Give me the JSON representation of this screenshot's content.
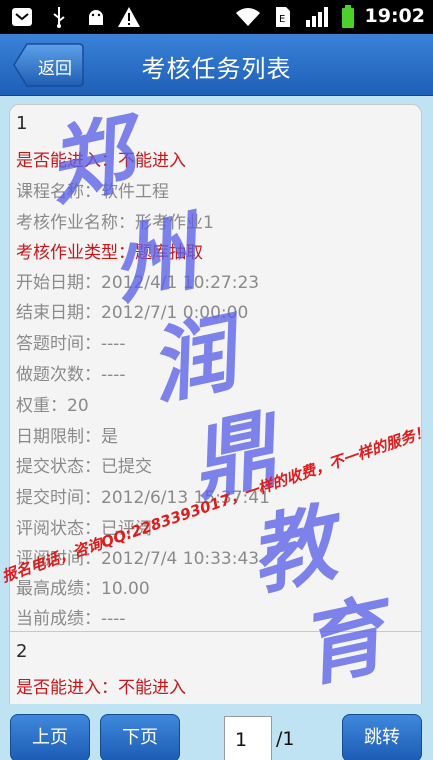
{
  "status_bar": {
    "time": "19:02",
    "icons": [
      "mail-icon",
      "usb-icon",
      "android-debug-icon",
      "warning-icon",
      "wifi-icon",
      "sim-icon",
      "signal-icon",
      "battery-icon"
    ],
    "battery_color": "#4cd12a"
  },
  "header": {
    "back_label": "返回",
    "title": "考核任务列表"
  },
  "records": [
    {
      "index": "1",
      "can_enter": "是否能进入：不能进入",
      "course_name": "课程名称：软件工程",
      "assignment_name": "考核作业名称：形考作业1",
      "assignment_type": "考核作业类型：题库抽取",
      "start_date": "开始日期：2012/4/1 10:27:23",
      "end_date": "结束日期：2012/7/1 0:00:00",
      "answer_time": "答题时间：----",
      "attempts": "做题次数：----",
      "weight": "权重：20",
      "date_limit": "日期限制：是",
      "submit_status": "提交状态：已提交",
      "submit_time": "提交时间：2012/6/13 15:37:41",
      "review_status": "评阅状态：已评阅",
      "review_time": "评阅时间：2012/7/4 10:33:43",
      "highest_score": "最高成绩：10.00",
      "current_score": "当前成绩：----"
    },
    {
      "index": "2",
      "can_enter": "是否能进入：不能进入"
    }
  ],
  "watermark": {
    "line": "报名电话，咨询QQ:2283393017，一样的收费，不一样的服务！",
    "brand": "郑州润鼎教育"
  },
  "pager": {
    "prev_label": "上页",
    "next_label": "下页",
    "current_page": "1",
    "total_pages": "/1",
    "jump_label": "跳转"
  },
  "colors": {
    "titlebar": "#2a6fca",
    "accent_red": "#c8171b",
    "page_bg": "#bfe3f3"
  }
}
